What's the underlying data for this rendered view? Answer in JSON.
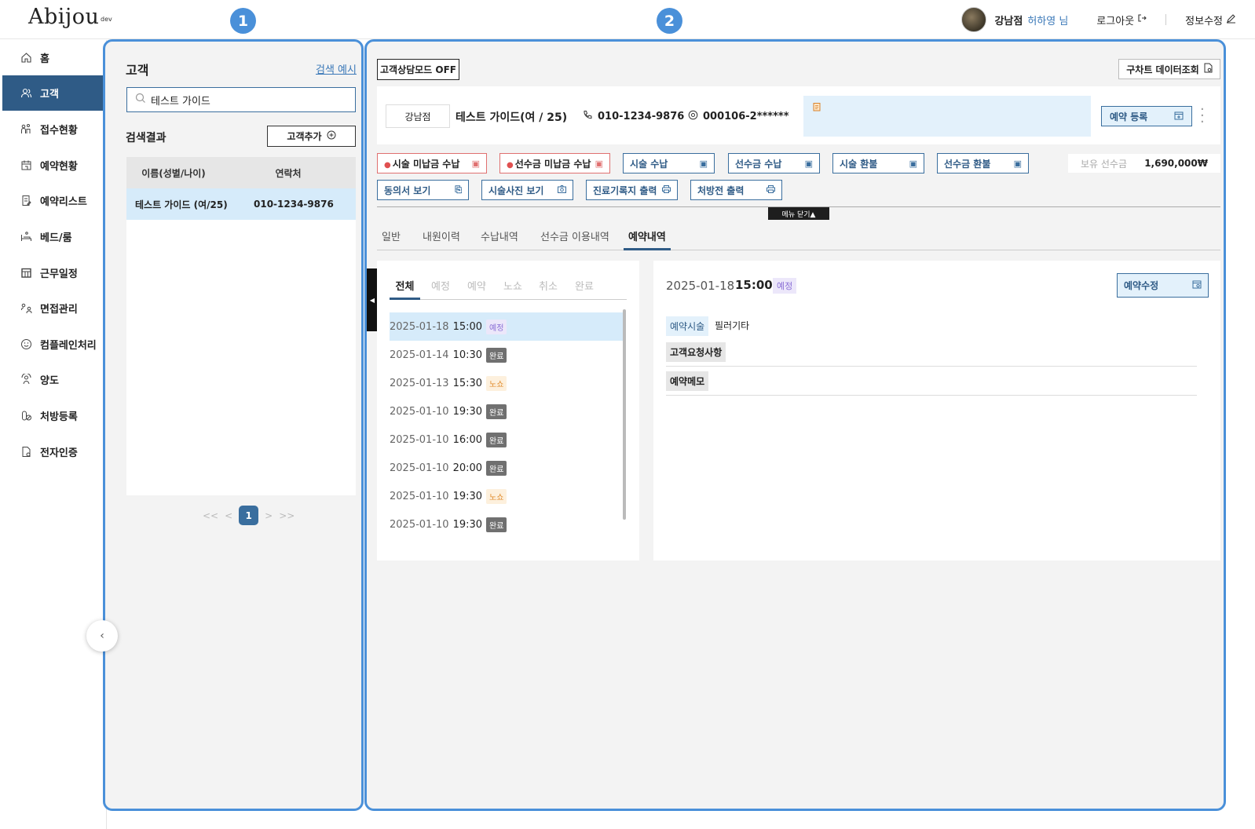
{
  "header": {
    "logo": "Abijou",
    "logo_tag": "dev",
    "branch": "강남점",
    "user": "허하영 님",
    "logout": "로그아웃",
    "edit_info": "정보수정"
  },
  "sidebar": {
    "items": [
      {
        "label": "홈",
        "icon": "home-icon"
      },
      {
        "label": "고객",
        "icon": "users-icon"
      },
      {
        "label": "접수현황",
        "icon": "reception-icon"
      },
      {
        "label": "예약현황",
        "icon": "calendar-icon"
      },
      {
        "label": "예약리스트",
        "icon": "list-icon"
      },
      {
        "label": "베드/룸",
        "icon": "bed-icon"
      },
      {
        "label": "근무일정",
        "icon": "schedule-icon"
      },
      {
        "label": "면접관리",
        "icon": "interview-icon"
      },
      {
        "label": "컴플레인처리",
        "icon": "smile-icon"
      },
      {
        "label": "양도",
        "icon": "transfer-icon"
      },
      {
        "label": "처방등록",
        "icon": "prescription-icon"
      },
      {
        "label": "전자인증",
        "icon": "certificate-icon"
      }
    ],
    "active_index": 1
  },
  "annotations": {
    "one": "1",
    "two": "2"
  },
  "customer_panel": {
    "title": "고객",
    "search_example": "검색 예시",
    "search_value": "테스트 가이드",
    "results_title": "검색결과",
    "add_button": "고객추가",
    "columns": [
      "이름(성별/나이)",
      "연락처"
    ],
    "rows": [
      {
        "name": "테스트 가이드 (여/25)",
        "phone": "010-1234-9876"
      }
    ],
    "pager": {
      "first": "<<",
      "prev": "<",
      "current": "1",
      "next": ">",
      "last": ">>"
    }
  },
  "detail_panel": {
    "mode_button": "고객상담모드 OFF",
    "chart_button": "구차트 데이터조회",
    "branch": "강남점",
    "customer_name": "테스트 가이드(여 / 25)",
    "phone": "010-1234-9876",
    "id_number": "000106-2******",
    "reserve_button": "예약 등록",
    "actions_row1": [
      "시술 미납금 수납",
      "선수금 미납금 수납",
      "시술 수납",
      "선수금 수납",
      "시술 환불",
      "선수금 환불"
    ],
    "actions_row2": [
      "동의서 보기",
      "시술사진 보기",
      "진료기록지 출력",
      "처방전 출력"
    ],
    "prepaid_label": "보유 선수금",
    "prepaid_value": "1,690,000₩",
    "menu_close": "메뉴 닫기▲",
    "tabs": [
      "일반",
      "내원이력",
      "수납내역",
      "선수금 이용내역",
      "예약내역"
    ],
    "active_tab": 4
  },
  "reservations": {
    "filters": [
      "전체",
      "예정",
      "예약",
      "노쇼",
      "취소",
      "완료"
    ],
    "items": [
      {
        "date": "2025-01-18",
        "time": "15:00",
        "status": "예정",
        "kind": "plan"
      },
      {
        "date": "2025-01-14",
        "time": "10:30",
        "status": "완료",
        "kind": "done"
      },
      {
        "date": "2025-01-13",
        "time": "15:30",
        "status": "노쇼",
        "kind": "noshow"
      },
      {
        "date": "2025-01-10",
        "time": "19:30",
        "status": "완료",
        "kind": "done"
      },
      {
        "date": "2025-01-10",
        "time": "16:00",
        "status": "완료",
        "kind": "done"
      },
      {
        "date": "2025-01-10",
        "time": "20:00",
        "status": "완료",
        "kind": "done"
      },
      {
        "date": "2025-01-10",
        "time": "19:30",
        "status": "노쇼",
        "kind": "noshow"
      },
      {
        "date": "2025-01-10",
        "time": "19:30",
        "status": "완료",
        "kind": "done"
      }
    ]
  },
  "reservation_detail": {
    "date": "2025-01-18",
    "time": "15:00",
    "status": "예정",
    "edit_button": "예약수정",
    "procedure_label": "예약시술",
    "procedure_value": "필러기타",
    "request_label": "고객요청사항",
    "memo_label": "예약메모"
  },
  "colors": {
    "primary": "#2f5b86",
    "accent": "#4a90d9",
    "highlight": "#d6ebfa"
  }
}
